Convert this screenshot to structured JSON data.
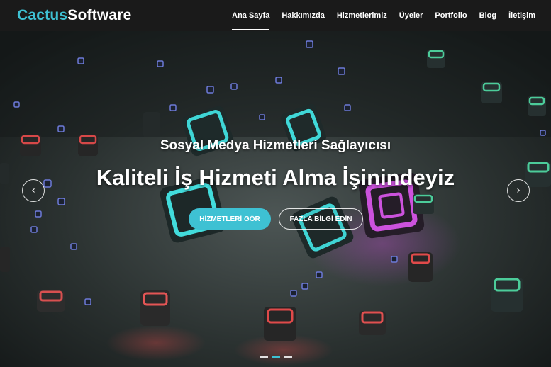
{
  "brand": {
    "accent": "Cactus",
    "rest": "Software"
  },
  "nav": {
    "items": [
      {
        "label": "Ana Sayfa",
        "active": true
      },
      {
        "label": "Hakkımızda"
      },
      {
        "label": "Hizmetlerimiz"
      },
      {
        "label": "Üyeler"
      },
      {
        "label": "Portfolio"
      },
      {
        "label": "Blog"
      },
      {
        "label": "İletişim"
      }
    ]
  },
  "hero": {
    "subtitle": "Sosyal Medya Hizmetleri Sağlayıcısı",
    "title": "Kaliteli İş Hizmeti Alma İşinindeyiz",
    "primary_button": "HİZMETLERİ GÖR",
    "secondary_button": "FAZLA BİLGİ EDİN",
    "prev_icon": "chevron-left-icon",
    "next_icon": "chevron-right-icon",
    "indicators": 3,
    "active_indicator": 2
  },
  "colors": {
    "accent": "#3ec1d3",
    "navbar": "#1a1a1a",
    "background": "#222828"
  }
}
